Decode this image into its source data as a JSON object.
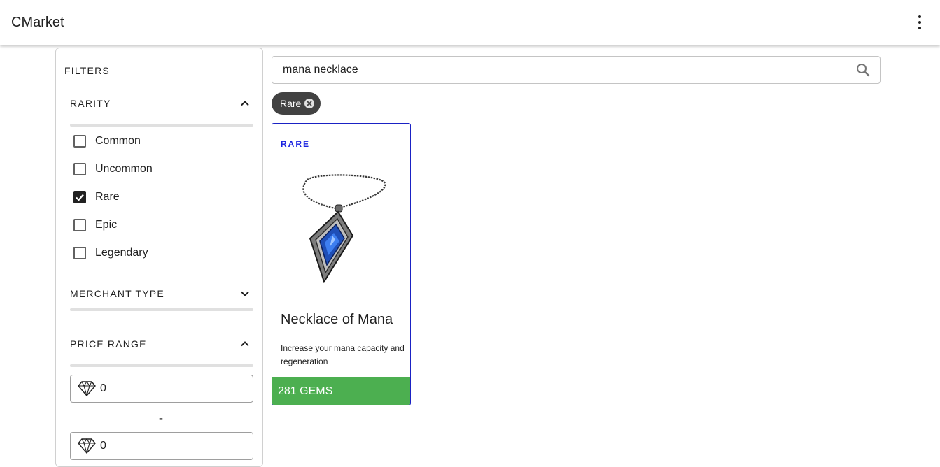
{
  "appbar": {
    "title": "CMarket",
    "menu_icon": "more-vert-icon"
  },
  "filters": {
    "title": "FILTERS",
    "rarity": {
      "label": "RARITY",
      "expanded": true,
      "options": [
        {
          "label": "Common",
          "checked": false
        },
        {
          "label": "Uncommon",
          "checked": false
        },
        {
          "label": "Rare",
          "checked": true
        },
        {
          "label": "Epic",
          "checked": false
        },
        {
          "label": "Legendary",
          "checked": false
        }
      ]
    },
    "merchant_type": {
      "label": "MERCHANT TYPE",
      "expanded": false
    },
    "price_range": {
      "label": "PRICE RANGE",
      "expanded": true,
      "min": "0",
      "separator": "-",
      "max": "0",
      "icon": "gem-icon"
    }
  },
  "search": {
    "value": "mana necklace",
    "icon": "search-icon"
  },
  "active_chips": [
    {
      "label": "Rare",
      "icon": "close-circle-icon"
    }
  ],
  "results": [
    {
      "rarity": "RARE",
      "name": "Necklace of Mana",
      "description": "Increase your mana capacity and regeneration",
      "price": "281 GEMS",
      "rarity_color": "#1a22e0",
      "price_bg": "#4caf50"
    }
  ]
}
